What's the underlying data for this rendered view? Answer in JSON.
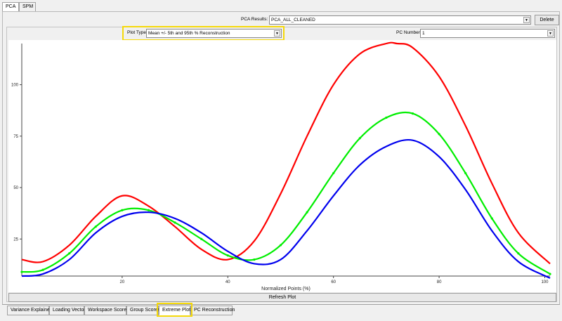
{
  "top_tabs": [
    {
      "label": "PCA"
    },
    {
      "label": "SPM"
    }
  ],
  "pca_results": {
    "label": "PCA Results:",
    "value": "PCA_ALL_CLEANED",
    "delete_label": "Delete"
  },
  "plot_type": {
    "label": "Plot Type",
    "value": "Mean +/- 5th and 95th % Reconstruction"
  },
  "pc_number": {
    "label": "PC Number",
    "value": "1"
  },
  "chart_data": {
    "type": "line",
    "xlabel": "Normalized Points (%)",
    "ylabel": "",
    "xlim": [
      1,
      101
    ],
    "ylim": [
      7,
      120
    ],
    "x_ticks": [
      20,
      40,
      60,
      80,
      100
    ],
    "y_ticks": [
      25,
      50,
      75,
      100
    ],
    "x_tick_labels": [
      "20",
      "40",
      "60",
      "80",
      "100"
    ],
    "y_tick_labels": [
      "25",
      "50",
      "75",
      "100"
    ],
    "grid": false,
    "series": [
      {
        "color": "#ff0000",
        "x": [
          1,
          5,
          10,
          15,
          20,
          25,
          30,
          35,
          40,
          45,
          50,
          55,
          60,
          65,
          70,
          72,
          75,
          80,
          85,
          90,
          95,
          101
        ],
        "y": [
          15,
          14,
          22,
          36,
          46,
          41,
          31,
          20,
          15,
          24,
          47,
          75,
          100,
          115,
          120,
          120,
          118,
          104,
          80,
          52,
          28,
          13
        ]
      },
      {
        "color": "#00ee00",
        "markers": true,
        "x": [
          1,
          5,
          10,
          15,
          20,
          25,
          30,
          35,
          40,
          45,
          50,
          55,
          60,
          65,
          70,
          75,
          80,
          85,
          90,
          95,
          101
        ],
        "y": [
          9,
          10,
          18,
          31,
          39,
          39,
          33,
          25,
          17,
          15,
          22,
          38,
          57,
          74,
          84,
          86,
          76,
          57,
          35,
          18,
          8
        ]
      },
      {
        "color": "#0000ee",
        "x": [
          1,
          5,
          10,
          15,
          20,
          25,
          30,
          35,
          40,
          45,
          50,
          55,
          60,
          65,
          70,
          75,
          80,
          85,
          90,
          95,
          101
        ],
        "y": [
          7,
          8,
          15,
          28,
          36,
          38,
          35,
          28,
          19,
          13,
          15,
          29,
          46,
          61,
          70,
          73,
          65,
          49,
          29,
          14,
          6
        ]
      }
    ]
  },
  "refresh_label": "Refresh Plot",
  "bottom_tabs": [
    {
      "label": "Variance Explained"
    },
    {
      "label": "Loading Vector"
    },
    {
      "label": "Workspace Scores"
    },
    {
      "label": "Group Scores"
    },
    {
      "label": "Extreme Plot"
    },
    {
      "label": "PC Reconstruction"
    }
  ],
  "colors": {
    "highlight": "#f5d90a",
    "red": "#ff0000",
    "green": "#00ee00",
    "blue": "#0000ee"
  }
}
